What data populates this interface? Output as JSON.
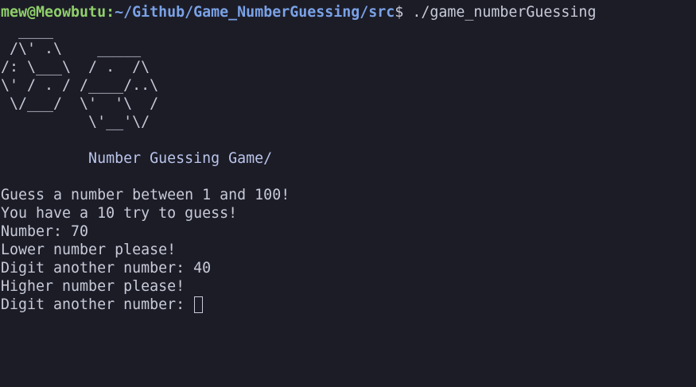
{
  "prompt": {
    "user_host": "mew@Meowbutu",
    "separator": ":",
    "path": "~/Github/Game_NumberGuessing/src",
    "symbol": "$",
    "command": " ./game_numberGuessing"
  },
  "ascii_art": [
    "  ____",
    " /\\' .\\    _____",
    "/: \\___\\  / .  /\\",
    "\\' / . / /____/..\\",
    " \\/___/  \\'  '\\  /",
    "          \\'__'\\/"
  ],
  "game_title": "          Number Guessing Game/",
  "output_lines": [
    "Guess a number between 1 and 100!",
    "You have a 10 try to guess!",
    "Number: 70",
    "Lower number please!",
    "Digit another number: 40",
    "Higher number please!"
  ],
  "current_prompt": "Digit another number: "
}
